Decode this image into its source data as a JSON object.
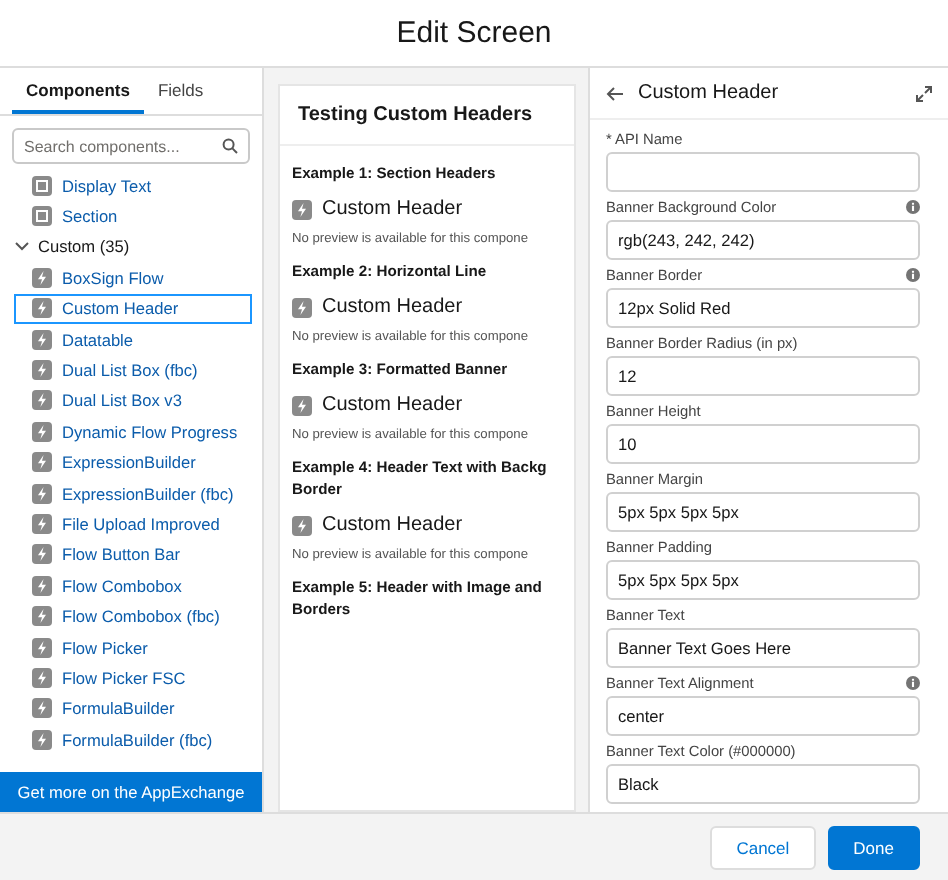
{
  "window": {
    "title": "Edit Screen"
  },
  "left_panel": {
    "tabs": [
      {
        "label": "Components",
        "selected": true
      },
      {
        "label": "Fields",
        "selected": false
      }
    ],
    "search": {
      "placeholder": "Search components..."
    },
    "items": [
      {
        "kind": "component",
        "label": "Display Text",
        "selected": false
      },
      {
        "kind": "component",
        "label": "Section",
        "selected": false
      },
      {
        "kind": "group",
        "label": "Custom (35)",
        "expanded": true,
        "children": [
          {
            "kind": "component",
            "label": "BoxSign Flow",
            "selected": false
          },
          {
            "kind": "component",
            "label": "Custom Header",
            "selected": true
          },
          {
            "kind": "component",
            "label": "Datatable",
            "selected": false
          },
          {
            "kind": "component",
            "label": "Dual List Box (fbc)",
            "selected": false
          },
          {
            "kind": "component",
            "label": "Dual List Box v3",
            "selected": false
          },
          {
            "kind": "component",
            "label": "Dynamic Flow Progress",
            "selected": false
          },
          {
            "kind": "component",
            "label": "ExpressionBuilder",
            "selected": false
          },
          {
            "kind": "component",
            "label": "ExpressionBuilder (fbc)",
            "selected": false
          },
          {
            "kind": "component",
            "label": "File Upload Improved",
            "selected": false
          },
          {
            "kind": "component",
            "label": "Flow Button Bar",
            "selected": false
          },
          {
            "kind": "component",
            "label": "Flow Combobox",
            "selected": false
          },
          {
            "kind": "component",
            "label": "Flow Combobox (fbc)",
            "selected": false
          },
          {
            "kind": "component",
            "label": "Flow Picker",
            "selected": false
          },
          {
            "kind": "component",
            "label": "Flow Picker FSC",
            "selected": false
          },
          {
            "kind": "component",
            "label": "FormulaBuilder",
            "selected": false
          },
          {
            "kind": "component",
            "label": "FormulaBuilder (fbc)",
            "selected": false
          }
        ]
      }
    ],
    "appexchange_link": "Get more on the AppExchange"
  },
  "canvas": {
    "title": "Testing Custom Headers",
    "blocks": [
      {
        "kind": "heading",
        "lines": [
          "Example 1: Section Headers"
        ]
      },
      {
        "kind": "component",
        "label": "Custom Header",
        "note": "No preview is available for this compone"
      },
      {
        "kind": "heading",
        "lines": [
          "Example 2: Horizontal Line"
        ]
      },
      {
        "kind": "component",
        "label": "Custom Header",
        "note": "No preview is available for this compone"
      },
      {
        "kind": "heading",
        "lines": [
          "Example 3: Formatted Banner"
        ]
      },
      {
        "kind": "component",
        "label": "Custom Header",
        "note": "No preview is available for this compone"
      },
      {
        "kind": "heading",
        "lines": [
          "Example 4: Header Text with Backg",
          "Border"
        ]
      },
      {
        "kind": "component",
        "label": "Custom Header",
        "note": "No preview is available for this compone"
      },
      {
        "kind": "heading",
        "lines": [
          "Example 5: Header with Image and",
          "Borders"
        ]
      }
    ]
  },
  "properties": {
    "title": "Custom Header",
    "fields": [
      {
        "label": "* API Name",
        "info": false
      },
      {
        "label": "Banner Background Color",
        "value": "rgb(243, 242, 242)",
        "info": true
      },
      {
        "label": "Banner Border",
        "value": "12px Solid Red",
        "info": true
      },
      {
        "label": "Banner Border Radius (in px)",
        "value": "12",
        "info": false
      },
      {
        "label": "Banner Height",
        "value": "10",
        "info": false
      },
      {
        "label": "Banner Margin",
        "value": "5px 5px 5px 5px",
        "info": false
      },
      {
        "label": "Banner Padding",
        "value": "5px 5px 5px 5px",
        "info": false
      },
      {
        "label": "Banner Text",
        "value": "Banner Text Goes Here",
        "info": false
      },
      {
        "label": "Banner Text Alignment",
        "value": "center",
        "info": true
      },
      {
        "label": "Banner Text Color (#000000)",
        "value": "Black",
        "info": false
      }
    ]
  },
  "footer": {
    "buttons": [
      {
        "label": "Cancel",
        "kind": "neutral"
      },
      {
        "label": "Done",
        "kind": "brand"
      }
    ]
  }
}
